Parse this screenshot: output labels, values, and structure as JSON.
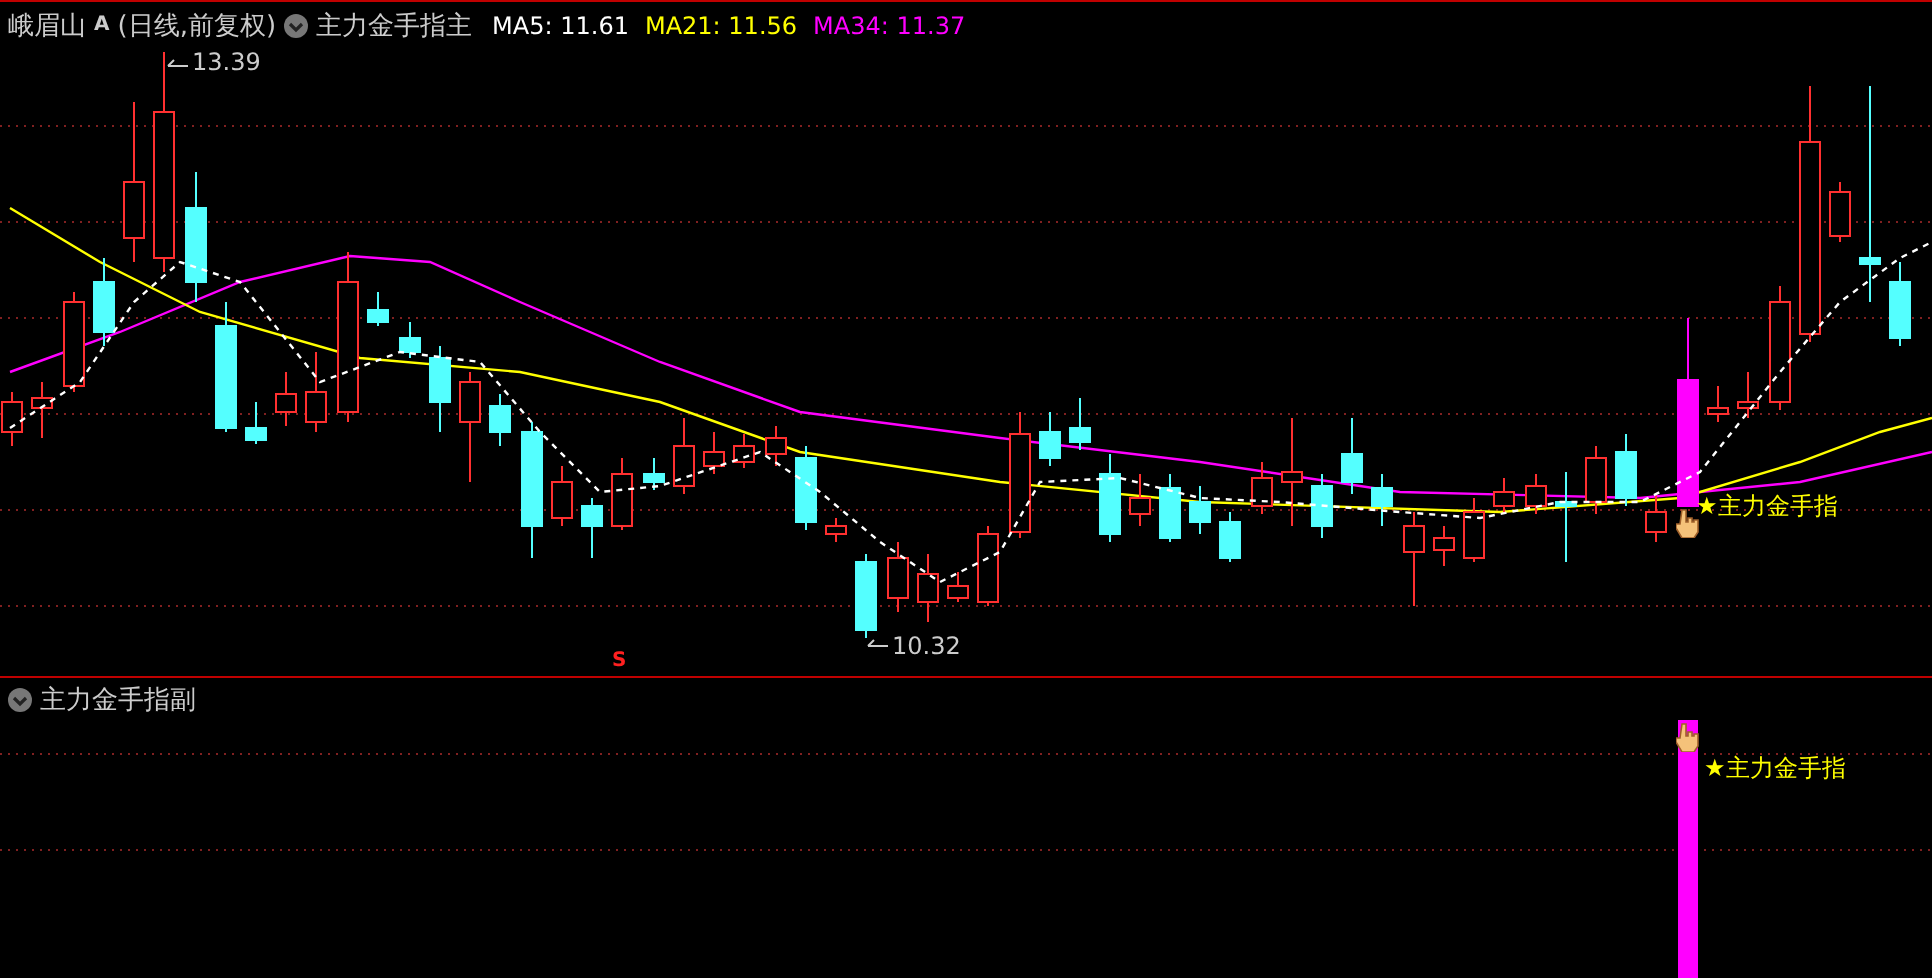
{
  "main_pane": {
    "stock_name": "峨眉山",
    "stock_tag": "A",
    "period": "(日线,前复权)",
    "indicator": "主力金手指主",
    "moving_averages": [
      {
        "label": "MA5:",
        "value": "11.61",
        "color": "#ffffff"
      },
      {
        "label": "MA21:",
        "value": "11.56",
        "color": "#ffff00"
      },
      {
        "label": "MA34:",
        "value": "11.37",
        "color": "#ff00ff"
      }
    ],
    "high_label": "13.39",
    "low_label": "10.32",
    "signal_mark": "S",
    "signal_label": "★主力金手指"
  },
  "sub_pane": {
    "indicator": "主力金手指副",
    "signal_label": "★主力金手指"
  }
}
